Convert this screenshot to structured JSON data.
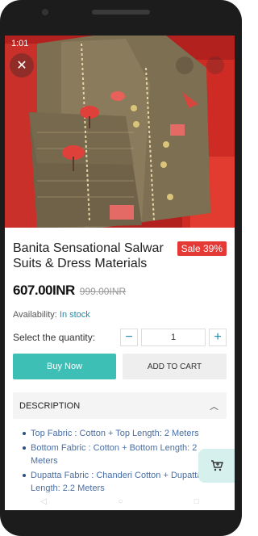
{
  "status_bar": {
    "time": "1:01"
  },
  "product": {
    "title": "Banita Sensational Salwar Suits & Dress Materials",
    "sale_badge": "Sale 39%",
    "price": "607.00INR",
    "old_price": "999.00INR",
    "availability_label": "Availability:",
    "availability_value": "In stock"
  },
  "quantity": {
    "label": "Select the quantity:",
    "value": "1",
    "minus": "−",
    "plus": "+"
  },
  "actions": {
    "buy_now": "Buy Now",
    "add_to_cart": "ADD TO CART"
  },
  "description": {
    "heading": "DESCRIPTION",
    "items": [
      "Top Fabric : Cotton + Top Length: 2 Meters",
      "Bottom Fabric : Cotton + Bottom Length: 2 Meters",
      "Dupatta Fabric : Chanderi Cotton + Dupatta Length: 2.2 Meters"
    ]
  },
  "icons": {
    "close": "close-icon",
    "cart": "add-cart-icon",
    "chevron": "chevron-up-icon"
  },
  "colors": {
    "accent": "#3dbfb5",
    "sale": "#e53935",
    "link": "#1e88a8"
  }
}
